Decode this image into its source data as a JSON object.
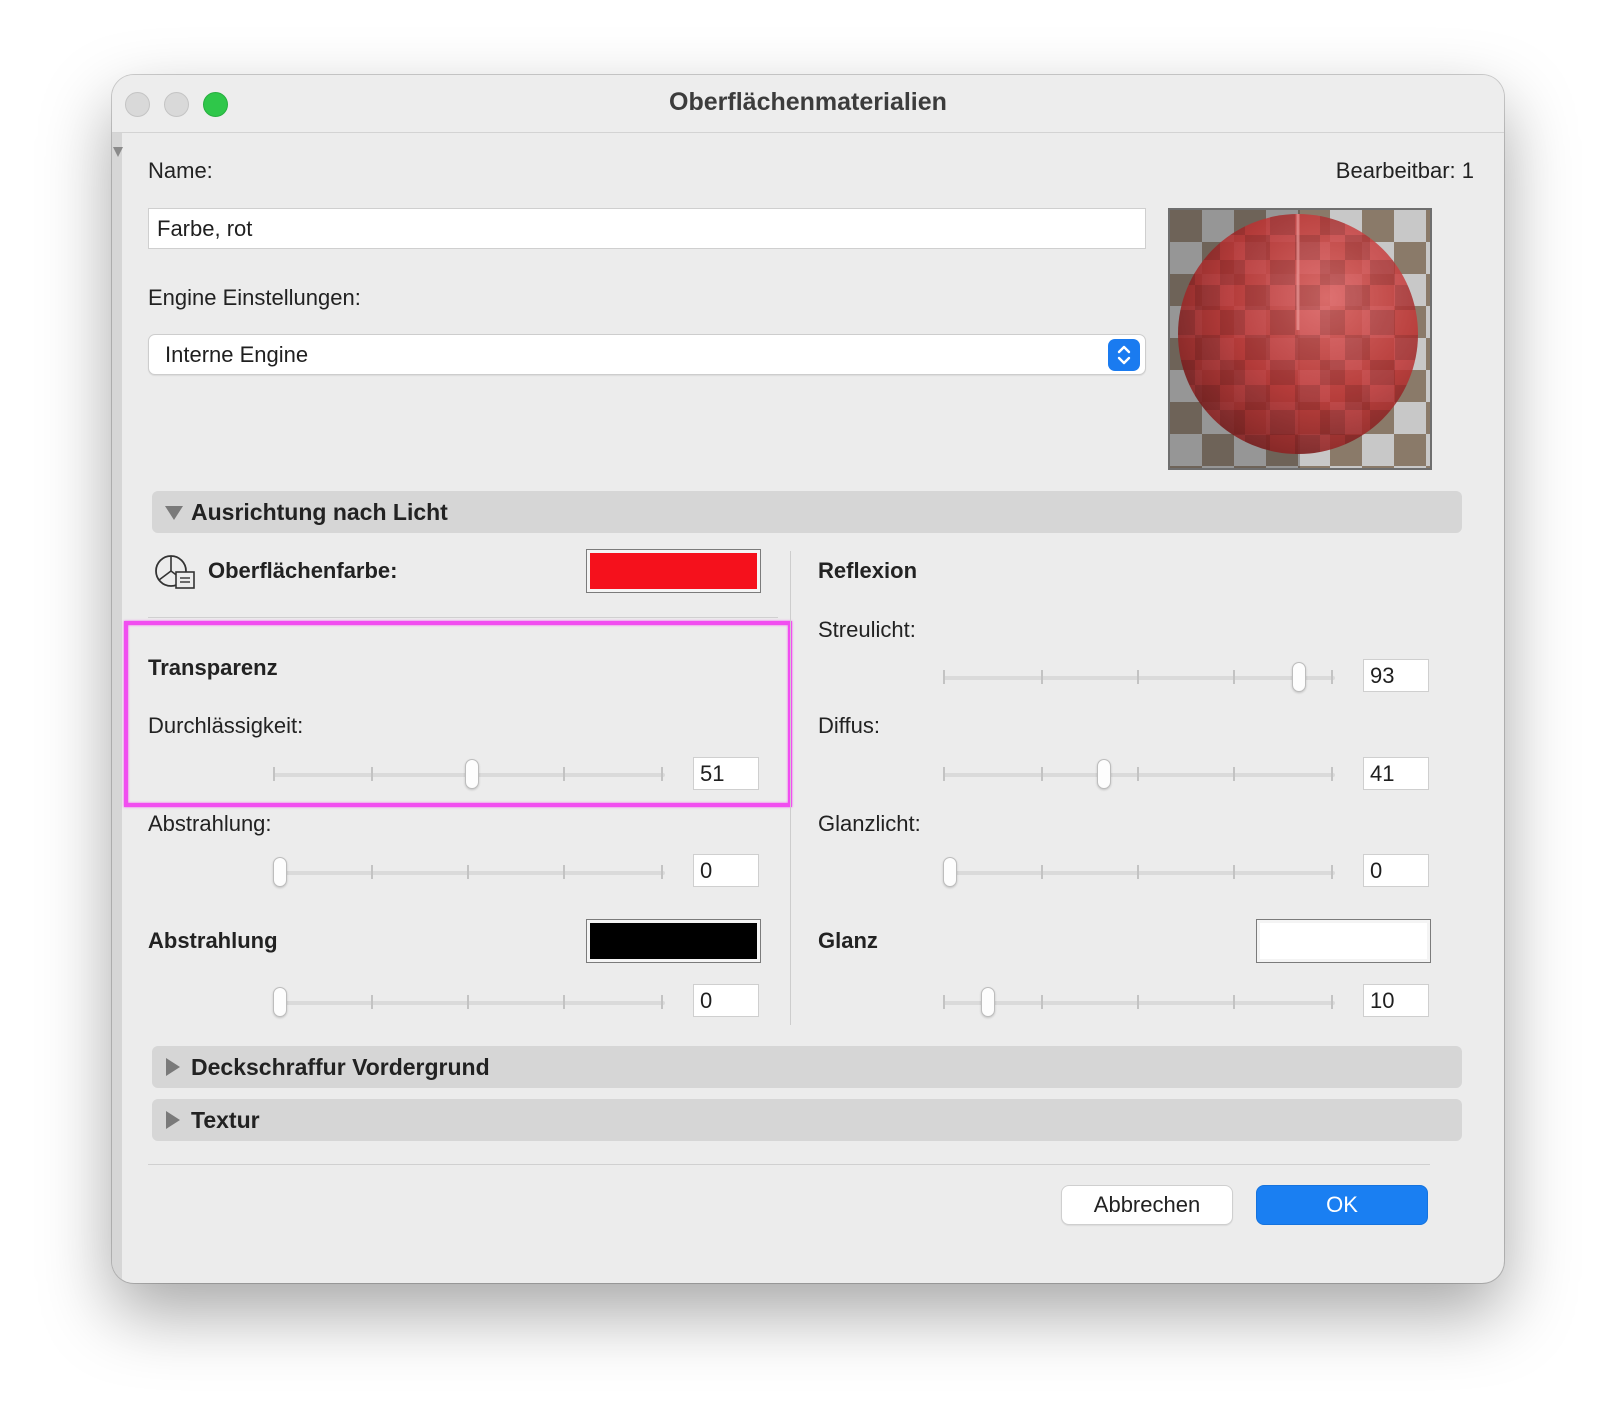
{
  "window": {
    "title": "Oberflächenmaterialien"
  },
  "header": {
    "name_label": "Name:",
    "editable_label": "Bearbeitbar: 1",
    "name_value": "Farbe, rot",
    "engine_label": "Engine Einstellungen:",
    "engine_selected": "Interne Engine"
  },
  "sections": {
    "light": "Ausrichtung nach Licht",
    "foreground_hatch": "Deckschraffur Vordergrund",
    "texture": "Textur"
  },
  "surface_color": {
    "label": "Oberflächenfarbe:",
    "color": "#f5111c",
    "icon": "color-palette-brush-icon"
  },
  "transparency": {
    "heading": "Transparenz",
    "permeability": {
      "label": "Durchlässigkeit:",
      "value": "51"
    },
    "emission": {
      "label": "Abstrahlung:",
      "value": "0"
    }
  },
  "emission": {
    "heading": "Abstrahlung",
    "color": "#000000",
    "value": "0"
  },
  "reflection": {
    "heading": "Reflexion",
    "ambient": {
      "label": "Streulicht:",
      "value": "93"
    },
    "diffuse": {
      "label": "Diffus:",
      "value": "41"
    },
    "specular": {
      "label": "Glanzlicht:",
      "value": "0"
    }
  },
  "shininess": {
    "heading": "Glanz",
    "color": "#ffffff",
    "value": "10"
  },
  "buttons": {
    "cancel": "Abbrechen",
    "ok": "OK"
  },
  "colors": {
    "accent": "#1a7ff2",
    "highlight": "#f14ef0"
  }
}
